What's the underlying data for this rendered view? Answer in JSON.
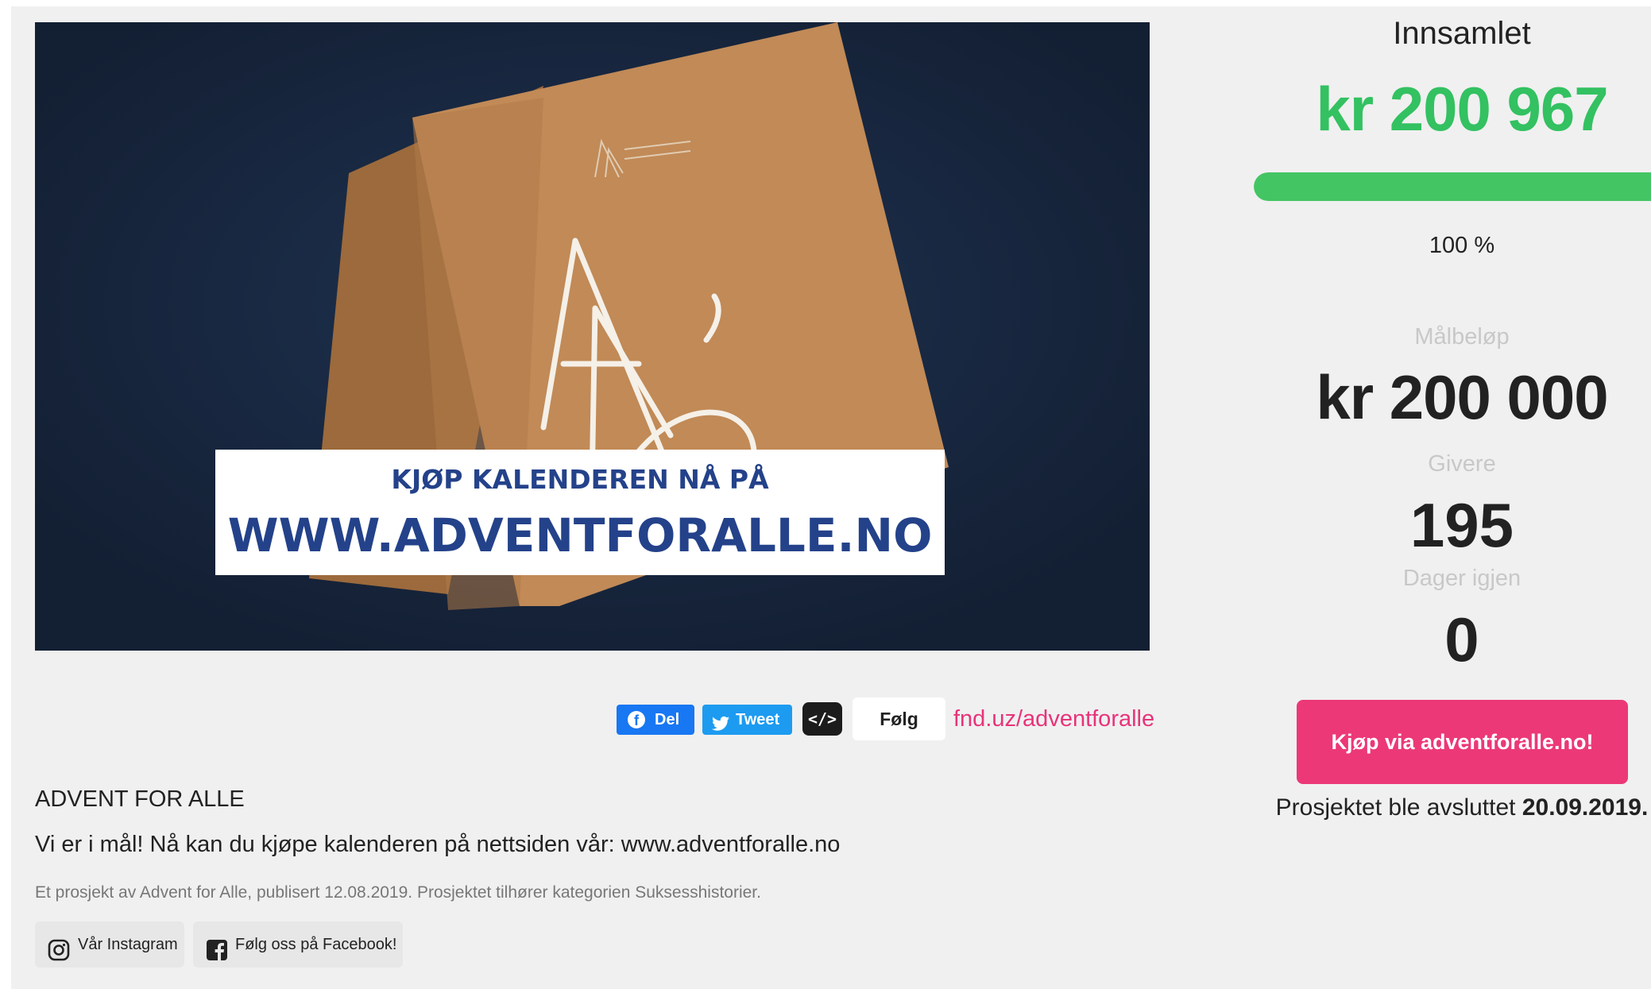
{
  "hero": {
    "banner_line1": "KJØP KALENDEREN NÅ PÅ",
    "banner_line2": "WWW.ADVENTFORALLE.NO"
  },
  "share": {
    "facebook_label": "Del",
    "tweet_label": "Tweet",
    "embed_label": "</>",
    "follow_label": "Følg",
    "short_link": "fnd.uz/adventforalle"
  },
  "project": {
    "title": "ADVENT FOR ALLE",
    "description": "Vi er i mål! Nå kan du kjøpe kalenderen på nettsiden vår: www.adventforalle.no",
    "meta": "Et prosjekt av Advent for Alle, publisert 12.08.2019. Prosjektet tilhører kategorien Suksesshistorier.",
    "instagram_label": "Vår Instagram",
    "facebook_label": "Følg oss på Facebook!"
  },
  "stats": {
    "raised_label": "Innsamlet",
    "raised_value": "kr 200 967",
    "progress_percent": 100,
    "progress_text": "100 %",
    "goal_label": "Målbeløp",
    "goal_value": "kr 200 000",
    "givers_label": "Givere",
    "givers_value": "195",
    "days_label": "Dager igjen",
    "days_value": "0",
    "buy_button": "Kjøp via adventforalle.no!",
    "ended_prefix": "Prosjektet ble avsluttet",
    "ended_date": "20.09.2019."
  },
  "colors": {
    "raised_green": "#33c161",
    "progress_green": "#43c563",
    "buy_pink": "#ec3877",
    "link_pink": "#e8337a",
    "hero_navy": "#15243b",
    "banner_blue": "#24428a"
  }
}
